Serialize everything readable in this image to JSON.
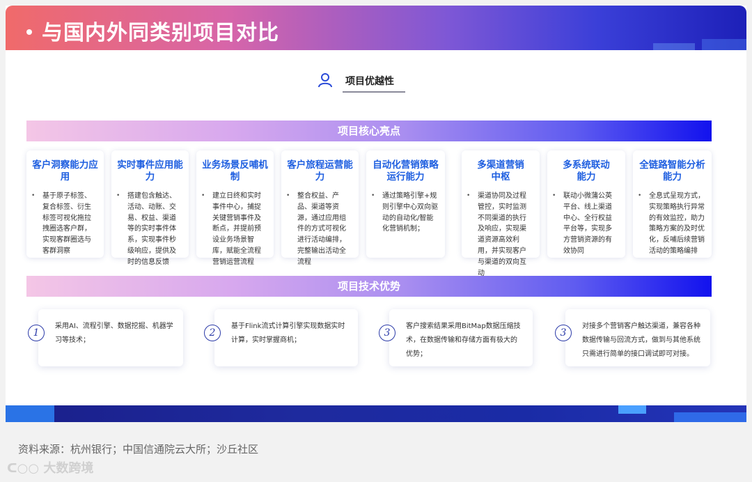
{
  "title": "与国内外同类别项目对比",
  "header": {
    "label": "项目优越性",
    "icon": "user-icon"
  },
  "section_highlights": {
    "title": "项目核心亮点"
  },
  "highlights": [
    {
      "title": "客户洞察能力应用",
      "body": "基于原子标签、复合标签、衍生标签可视化拖拉拽圈选客户群，实现客群圈选与客群洞察"
    },
    {
      "title": "实时事件应用能力",
      "body": "搭建包含触达、活动、动账、交易、权益、渠道等的实时事件体系，实现事件秒级响应，提供及时的信息反馈"
    },
    {
      "title": "业务场景反哺机制",
      "body": "建立日终和实时事件中心，捕捉关键营销事件及断点，并提前预设业务场景智库，赋能全流程营销运营流程"
    },
    {
      "title": "客户旅程运营能力",
      "body": "整合权益、产品、渠道等资源，通过应用组件的方式可视化进行活动编排，完整输出活动全流程"
    },
    {
      "title": "自动化营销策略运行能力",
      "body": "通过策略引擎+规则引擎中心双向驱动的自动化/智能化营销机制；"
    },
    {
      "title": "多渠道营销中枢",
      "body": "渠道协同及过程管控，实时监测不同渠道的执行及响应，实现渠道资源高效利用，并实现客户与渠道的双向互动"
    },
    {
      "title": "多系统联动能力",
      "body": "联动小微蒲公英平台、线上渠道中心、全行权益平台等，实现多方营销资源的有效协同"
    },
    {
      "title": "全链路智能分析能力",
      "body": "全息式呈现方式，实现策略执行异常的有效监控，助力策略方案的及时优化，反哺后续营销活动的策略编排"
    }
  ],
  "section_tech": {
    "title": "项目技术优势"
  },
  "advantages": [
    {
      "num": "1",
      "body": "采用AI、流程引擎、数据挖掘、机器学习等技术；"
    },
    {
      "num": "2",
      "body": "基于Flink流式计算引擎实现数据实时计算，实时掌握商机；"
    },
    {
      "num": "3",
      "body": "客户搜索结果采用BitMap数据压缩技术，在数据传输和存储方面有极大的优势；"
    },
    {
      "num": "3",
      "body": "对接多个营销客户触达渠道，兼容各种数据传输与回流方式，做到与其他系统只需进行简单的接口调试即可对接。"
    }
  ],
  "source": "资料来源：杭州银行；中国信通院云大所；沙丘社区",
  "watermark": "大数跨境",
  "colors": {
    "accent": "#1f5fe0",
    "band_end": "#1212ee",
    "title_start": "#f06a6a",
    "title_end": "#1d20b8"
  }
}
